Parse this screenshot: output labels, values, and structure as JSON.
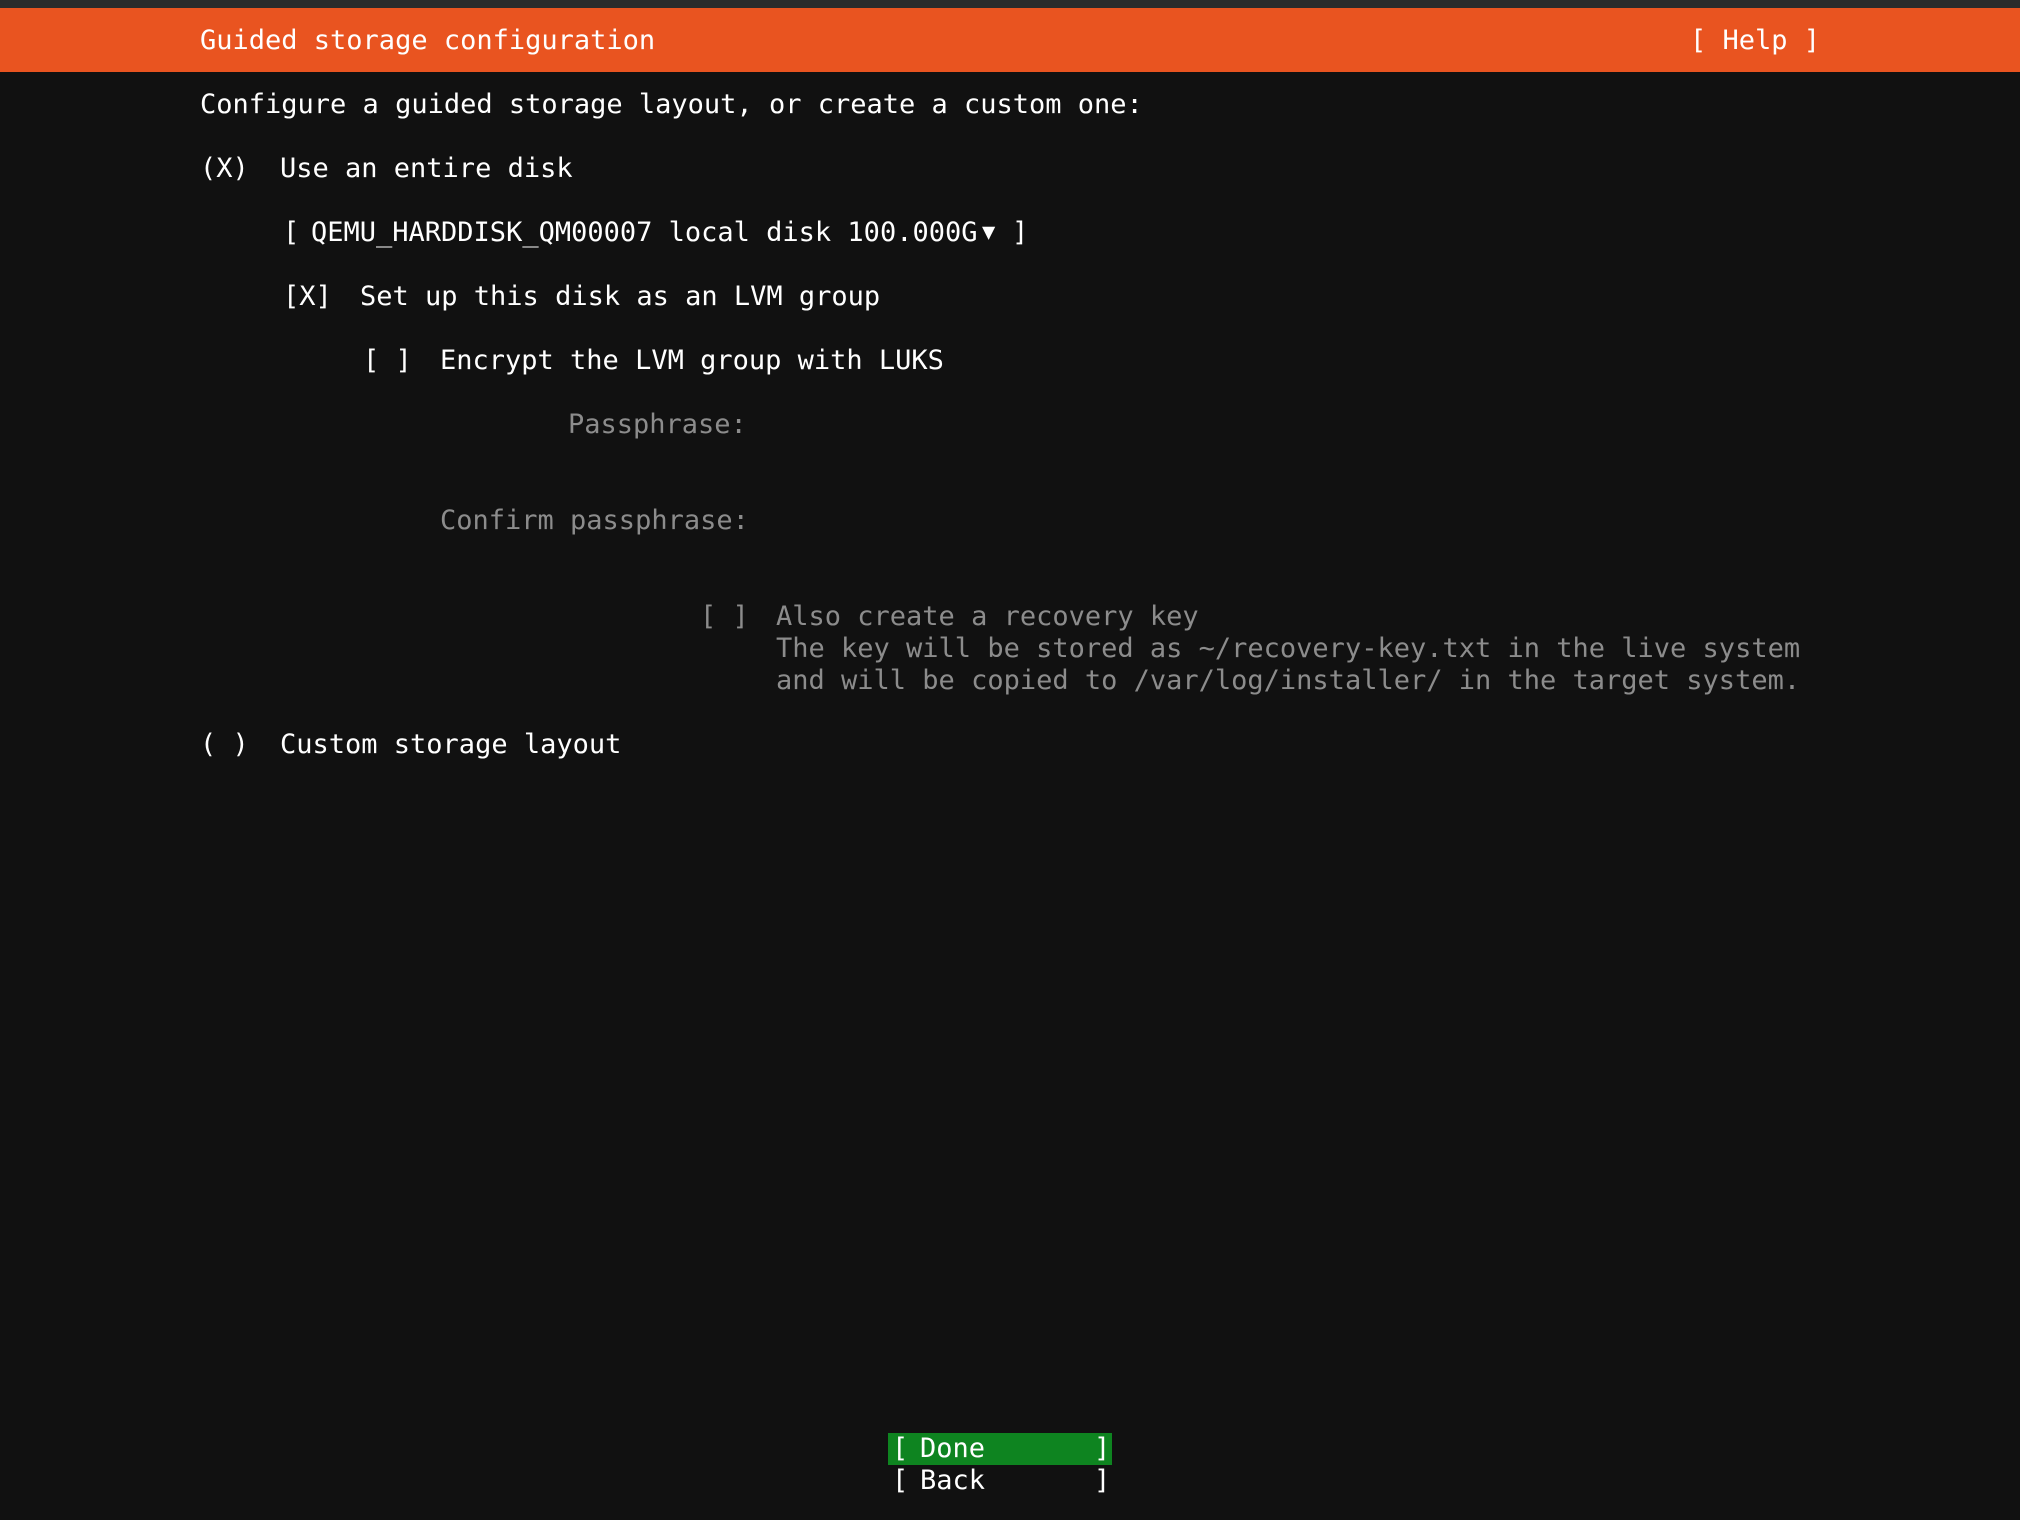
{
  "header": {
    "title": "Guided storage configuration",
    "help": "[ Help ]"
  },
  "intro": "Configure a guided storage layout, or create a custom one:",
  "options": {
    "entire_disk": {
      "marker": "(X)",
      "label": "Use an entire disk"
    },
    "disk_select": {
      "open": "[",
      "value": "QEMU_HARDDISK_QM00007 local disk 100.000G",
      "arrow": "▼",
      "close": "]"
    },
    "lvm": {
      "marker": "[X]",
      "label": "Set up this disk as an LVM group"
    },
    "luks": {
      "marker": "[ ]",
      "label": "Encrypt the LVM group with LUKS"
    },
    "passphrase": {
      "label": "Passphrase:",
      "value": ""
    },
    "confirm_passphrase": {
      "label": "Confirm passphrase:",
      "value": ""
    },
    "recovery": {
      "marker": "[ ]",
      "label": "Also create a recovery key",
      "desc_line1": "The key will be stored as ~/recovery-key.txt in the live system",
      "desc_line2": "and will be copied to /var/log/installer/ in the target system."
    },
    "custom": {
      "marker": "( )",
      "label": "Custom storage layout"
    }
  },
  "buttons": {
    "done": "Done",
    "back": "Back",
    "open": "[",
    "close": "]"
  },
  "colors": {
    "header_bg": "#e95420",
    "background": "#111111",
    "done_bg": "#0e8420",
    "dim_text": "#8c8c8c"
  }
}
